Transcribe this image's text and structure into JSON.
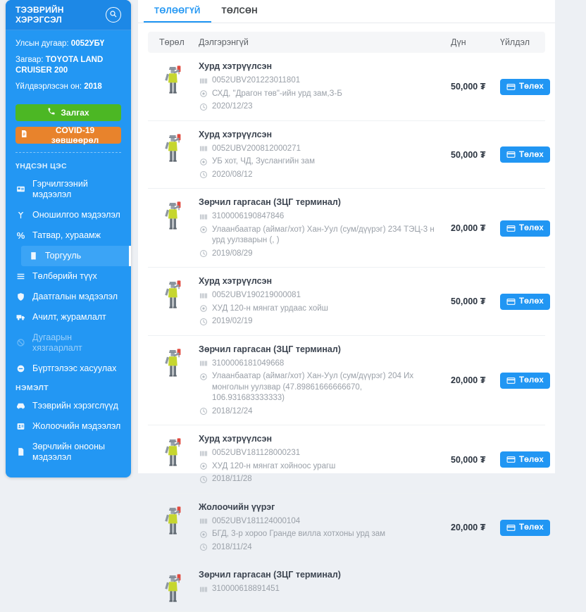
{
  "colors": {
    "sidebar_blue": "#2397f3",
    "sidebar_header_blue": "#1d88e6",
    "active_item_blue": "#3ba4f6",
    "accent_blue": "#2196f3",
    "call_green": "#4cb724",
    "covid_orange": "#e8832c",
    "vest_yellow": "#c6d62f",
    "paddle_red": "#e04a3f"
  },
  "sidebar": {
    "title": "ТЭЭВРИЙН ХЭРЭГСЭЛ",
    "search_icon": "search-icon",
    "vehicle": {
      "plate_label": "Улсын дугаар: ",
      "plate": "0052УБҮ",
      "model_label": "Загвар: ",
      "model": "TOYOTA LAND CRUISER 200",
      "year_label": "Үйлдвэрлэсэн он: ",
      "year": "2018"
    },
    "call_button": "Залгах",
    "covid_button": "COVID-19 зөвшөөрөл",
    "sections": [
      {
        "header": "ҮНДСЭН ЦЭС",
        "items": [
          {
            "name": "certificate-info",
            "icon": "id-card",
            "label": "Гэрчилгээний мэдээлэл"
          },
          {
            "name": "diagnostic-info",
            "icon": "stethoscope",
            "label": "Оношилгоо мэдээлэл"
          },
          {
            "name": "tax-fees",
            "icon": "percent",
            "label": "Татвар, хураамж"
          },
          {
            "name": "fines",
            "icon": "receipt",
            "label": "Торгууль",
            "active": true,
            "sub": true
          },
          {
            "name": "payment-history",
            "icon": "list",
            "label": "Төлбөрийн түүх"
          },
          {
            "name": "insurance-info",
            "icon": "shield",
            "label": "Даатгалын мэдээлэл"
          },
          {
            "name": "loading-rules",
            "icon": "truck",
            "label": "Ачилт, журамлалт"
          },
          {
            "name": "number-restriction",
            "icon": "ban",
            "label": "Дугаарын хязгаарлалт",
            "disabled": true
          },
          {
            "name": "deregistration",
            "icon": "minus-circle",
            "label": "Бүртгэлээс хасуулах"
          }
        ]
      },
      {
        "header": "НЭМЭЛТ",
        "items": [
          {
            "name": "vehicles",
            "icon": "car",
            "label": "Тээврийн хэрэгслүүд"
          },
          {
            "name": "driver-info",
            "icon": "id-badge",
            "label": "Жолоочийн мэдээлэл"
          },
          {
            "name": "penalty-points-info",
            "icon": "file",
            "label": "Зөрчлийн онооны мэдээлэл"
          }
        ]
      }
    ]
  },
  "main": {
    "tabs": [
      {
        "label": "ТӨЛӨӨГҮЙ",
        "active": true
      },
      {
        "label": "ТӨЛСӨН",
        "active": false
      }
    ],
    "table": {
      "headers": [
        "Төрөл",
        "Дэлгэрэнгүй",
        "Дүн",
        "Үйлдэл"
      ],
      "pay_button_label": "Төлөх",
      "row_type_icon": "traffic-officer",
      "rows": [
        {
          "title": "Хурд хэтрүүлсэн",
          "code": "0052UBV201223011801",
          "location": "СХД, \"Драгон төв\"-ийн урд зам,З-Б",
          "date": "2020/12/23",
          "amount": "50,000 ₮"
        },
        {
          "title": "Хурд хэтрүүлсэн",
          "code": "0052UBV200812000271",
          "location": "УБ хот, ЧД, Зуслангийн зам",
          "date": "2020/08/12",
          "amount": "50,000 ₮"
        },
        {
          "title": "Зөрчил гаргасан (ЗЦГ терминал)",
          "code": "3100006190847846",
          "location": "Улаанбаатар (аймаг/хот) Хан-Уул (сум/дүүрэг) 234 ТЭЦ-3 н урд уулзварын (, )",
          "date": "2019/08/29",
          "amount": "20,000 ₮"
        },
        {
          "title": "Хурд хэтрүүлсэн",
          "code": "0052UBV190219000081",
          "location": "ХУД 120-н мянгат урдаас хойш",
          "date": "2019/02/19",
          "amount": "50,000 ₮"
        },
        {
          "title": "Зөрчил гаргасан (ЗЦГ терминал)",
          "code": "3100006181049668",
          "location": "Улаанбаатар (аймаг/хот) Хан-Уул (сум/дүүрэг) 204 Их монголын уулзвар (47.89861666666670, 106.931683333333)",
          "date": "2018/12/24",
          "amount": "20,000 ₮"
        },
        {
          "title": "Хурд хэтрүүлсэн",
          "code": "0052UBV181128000231",
          "location": "ХУД 120-н мянгат хойноос урагш",
          "date": "2018/11/28",
          "amount": "50,000 ₮"
        },
        {
          "title": "Жолоочийн үүрэг",
          "code": "0052UBV181124000104",
          "location": "БГД, 3-р хороо Гранде вилла хотхоны урд зам",
          "date": "2018/11/24",
          "amount": "20,000 ₮"
        },
        {
          "title": "Зөрчил гаргасан (ЗЦГ терминал)",
          "code": "310000618891451",
          "location": null,
          "date": null,
          "amount": null
        }
      ]
    }
  }
}
